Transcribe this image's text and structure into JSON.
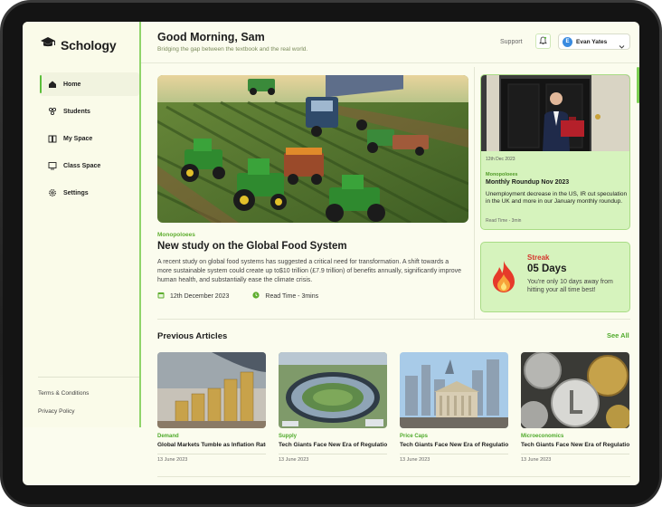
{
  "app": {
    "name": "Schology"
  },
  "sidebar": {
    "items": [
      {
        "label": "Home",
        "icon": "home-icon"
      },
      {
        "label": "Students",
        "icon": "students-icon"
      },
      {
        "label": "My Space",
        "icon": "book-icon"
      },
      {
        "label": "Class Space",
        "icon": "class-icon"
      },
      {
        "label": "Settings",
        "icon": "gear-icon"
      }
    ],
    "footer": {
      "terms": "Terms & Conditions",
      "privacy": "Privacy Policy"
    }
  },
  "header": {
    "greeting": "Good Morning, Sam",
    "subtitle": "Bridging the gap between the textbook and the real world.",
    "support": "Support",
    "user": {
      "initial": "E",
      "name": "Evan Yates"
    }
  },
  "featured": {
    "category": "Monopoloees",
    "title": "New study on the Global Food System",
    "body": "A recent study on global food systems has suggested a critical need for transformation. A shift towards a more sustainable system could create up to$10 trillion (£7.9 trillion) of benefits annually, significantly improve human health, and substantially ease the climate crisis.",
    "date": "12th December 2023",
    "read_time": "Read Time - 3mins"
  },
  "news_card": {
    "date": "12th Dec 2023",
    "category": "Monopoloees",
    "title": "Monthly Roundup Nov 2023",
    "body": "Unemployment decrease in the US, IR cut speculation in the UK and more in our January monthly roundup.",
    "read_time": "Read Time - 3min"
  },
  "streak": {
    "label": "Streak",
    "days": "05 Days",
    "message": "You're only 10 days away from hitting your all time best!"
  },
  "previous": {
    "title": "Previous Articles",
    "see_all": "See All",
    "articles": [
      {
        "category": "Demand",
        "title": "Global Markets Tumble as Inflation Rates Hit Decade Highs",
        "date": "13 June 2023"
      },
      {
        "category": "Supply",
        "title": "Tech Giants Face New Era of Regulation Amid Growing Privacy C...",
        "date": "13 June 2023"
      },
      {
        "category": "Price Caps",
        "title": "Tech Giants Face New Era of Regulation Amid Growing Privacy C...",
        "date": "13 June 2023"
      },
      {
        "category": "Microeconomics",
        "title": "Tech Giants Face New Era of Regulation Amid Growing Privacy C...",
        "date": "13 June 2023"
      }
    ]
  },
  "colors": {
    "accent": "#5fae2f",
    "card": "#d6f3bd",
    "streak": "#d6352e",
    "background": "#fbfcee"
  }
}
